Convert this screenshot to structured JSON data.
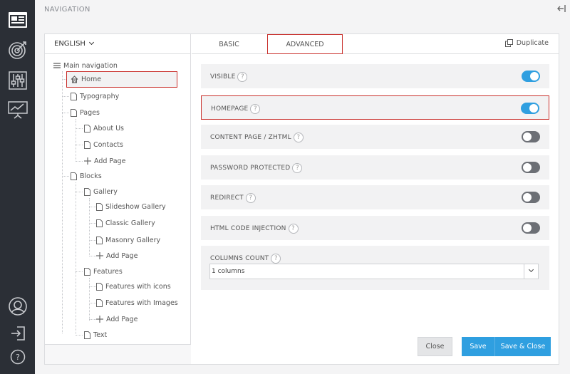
{
  "header": {
    "title": "NAVIGATION"
  },
  "sidebar_icons": [
    "content-icon",
    "target-icon",
    "sliders-icon",
    "presentation-icon",
    "avatar-icon",
    "login-icon",
    "help-icon"
  ],
  "language": {
    "selected": "ENGLISH"
  },
  "tree": {
    "root": "Main navigation",
    "home": "Home",
    "typography": "Typography",
    "pages": "Pages",
    "about": "About Us",
    "contacts": "Contacts",
    "add_page_pages": "Add Page",
    "blocks": "Blocks",
    "gallery": "Gallery",
    "slideshow": "Slideshow Gallery",
    "classic": "Classic Gallery",
    "masonry": "Masonry Gallery",
    "add_page_gallery": "Add Page",
    "features": "Features",
    "feat_icons": "Features with icons",
    "feat_images": "Features with Images",
    "add_page_features": "Add Page",
    "text": "Text"
  },
  "tabs": {
    "basic": "BASIC",
    "advanced": "ADVANCED"
  },
  "duplicate_label": "Duplicate",
  "settings": {
    "visible": {
      "label": "VISIBLE",
      "on": true
    },
    "homepage": {
      "label": "HOMEPAGE",
      "on": true
    },
    "content_page": {
      "label": "CONTENT PAGE / ZHTML",
      "on": false
    },
    "password": {
      "label": "PASSWORD PROTECTED",
      "on": false
    },
    "redirect": {
      "label": "REDIRECT",
      "on": false
    },
    "html_injection": {
      "label": "HTML CODE INJECTION",
      "on": false
    },
    "columns": {
      "label": "COLUMNS COUNT",
      "value": "1 columns"
    },
    "help_glyph": "?"
  },
  "buttons": {
    "close": "Close",
    "save": "Save",
    "save_close": "Save & Close"
  },
  "colors": {
    "accent": "#2f9fe0",
    "highlight": "#c9302c",
    "rail": "#2b2f36"
  }
}
